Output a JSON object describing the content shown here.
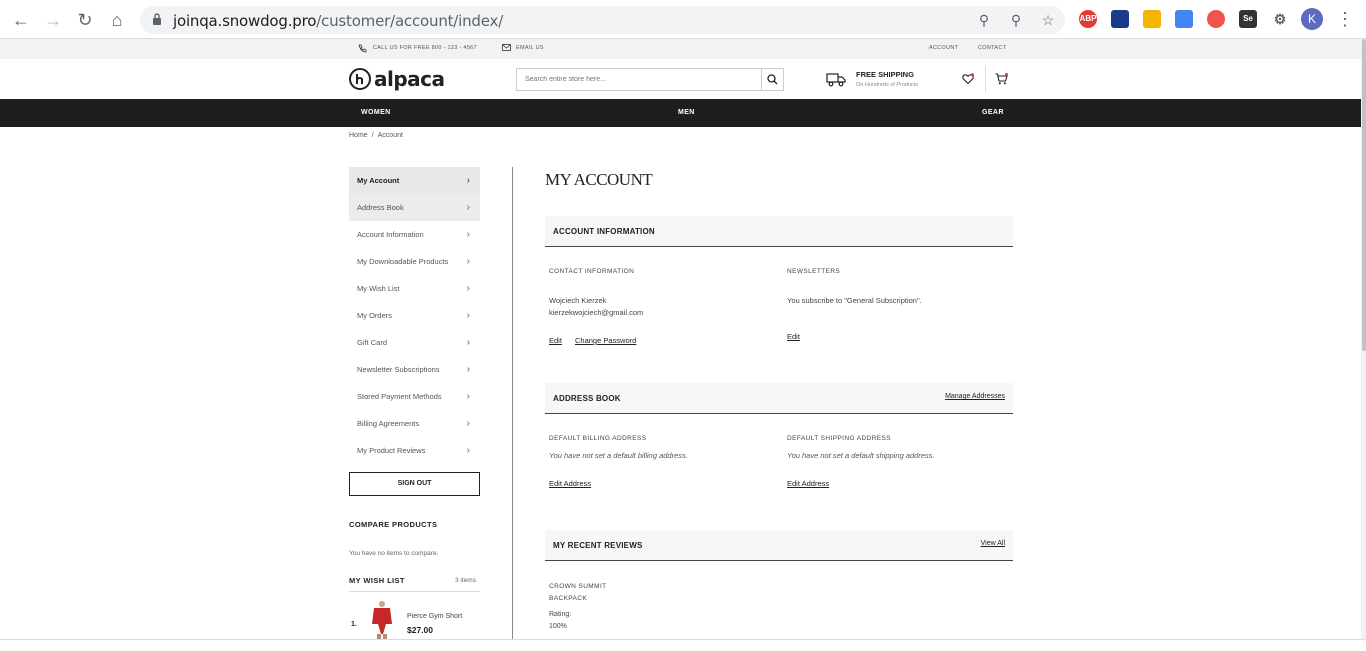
{
  "browser": {
    "url_host": "joinqa.snowdog.pro",
    "url_path": "/customer/account/index/",
    "profile_initial": "K",
    "extensions": [
      "ABP",
      "",
      "",
      "",
      "",
      "Se"
    ]
  },
  "topbar": {
    "call": "CALL US FOR FREE 800 - 123 - 4567",
    "email": "EMAIL US",
    "account": "ACCOUNT",
    "contact": "CONTACT"
  },
  "header": {
    "logo_text": "alpaca",
    "search_placeholder": "Search entire store here...",
    "shipping_title": "FREE SHIPPING",
    "shipping_sub": "On Hundreds of Products"
  },
  "nav": [
    "WOMEN",
    "MEN",
    "GEAR"
  ],
  "breadcrumb": {
    "home": "Home",
    "sep": "/",
    "current": "Account"
  },
  "sidebar": {
    "items": [
      "My Account",
      "Address Book",
      "Account Information",
      "My Downloadable Products",
      "My Wish List",
      "My Orders",
      "Gift Card",
      "Newsletter Subscriptions",
      "Stored Payment Methods",
      "Billing Agreements",
      "My Product Reviews"
    ],
    "sign_out": "SIGN OUT",
    "compare_title": "COMPARE PRODUCTS",
    "compare_empty": "You have no items to compare.",
    "wishlist_title": "MY WISH LIST",
    "wishlist_count": "3 items",
    "wishlist_item": {
      "num": "1.",
      "name": "Pierce Gym Short",
      "price": "$27.00"
    }
  },
  "main": {
    "title": "MY ACCOUNT",
    "account_info": {
      "heading": "ACCOUNT INFORMATION",
      "contact_label": "CONTACT INFORMATION",
      "name": "Wojciech Kierzek",
      "email": "kierzekwojciech@gmail.com",
      "edit": "Edit",
      "change_password": "Change Password",
      "newsletters_label": "NEWSLETTERS",
      "newsletters_text": "You subscribe to \"General Subscription\".",
      "newsletters_edit": "Edit"
    },
    "address_book": {
      "heading": "ADDRESS BOOK",
      "manage": "Manage Addresses",
      "billing_label": "DEFAULT BILLING ADDRESS",
      "billing_text": "You have not set a default billing address.",
      "billing_edit": "Edit Address",
      "shipping_label": "DEFAULT SHIPPING ADDRESS",
      "shipping_text": "You have not set a default shipping address.",
      "shipping_edit": "Edit Address"
    },
    "reviews": {
      "heading": "MY RECENT REVIEWS",
      "view_all": "View All",
      "product_line1": "CROWN SUMMIT",
      "product_line2": "BACKPACK",
      "rating_label": "Rating:",
      "rating_value": "100%"
    }
  }
}
